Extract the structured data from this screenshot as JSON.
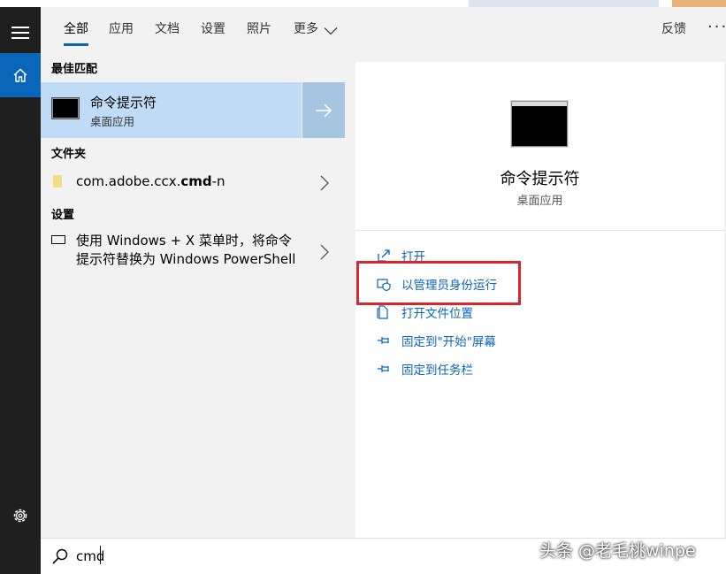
{
  "tabs": [
    {
      "label": "全部",
      "active": true
    },
    {
      "label": "应用"
    },
    {
      "label": "文档"
    },
    {
      "label": "设置"
    },
    {
      "label": "照片"
    },
    {
      "label": "更多"
    }
  ],
  "header": {
    "feedback": "反馈",
    "more_options": "···"
  },
  "results": {
    "best_match_heading": "最佳匹配",
    "best_match": {
      "title": "命令提示符",
      "subtitle": "桌面应用"
    },
    "folders_heading": "文件夹",
    "folder_item": {
      "prefix": "com.adobe.ccx.",
      "bold": "cmd",
      "suffix": "-n"
    },
    "settings_heading": "设置",
    "setting_item": {
      "line1": "使用 Windows + X 菜单时，将命令",
      "line2": "提示符替换为 Windows PowerShell"
    }
  },
  "detail": {
    "name": "命令提示符",
    "kind": "桌面应用",
    "actions": [
      {
        "label": "打开",
        "icon": "open-icon"
      },
      {
        "label": "以管理员身份运行",
        "icon": "shield-icon"
      },
      {
        "label": "打开文件位置",
        "icon": "file-location-icon"
      },
      {
        "label": "固定到\"开始\"屏幕",
        "icon": "pin-icon"
      },
      {
        "label": "固定到任务栏",
        "icon": "pin-icon"
      }
    ]
  },
  "search": {
    "value": "cmd"
  },
  "watermark": "头条 @老毛桃winpe",
  "colors": {
    "accent": "#0a66b8",
    "highlight_box": "#d9262c",
    "selected": "#c0dbf5"
  }
}
